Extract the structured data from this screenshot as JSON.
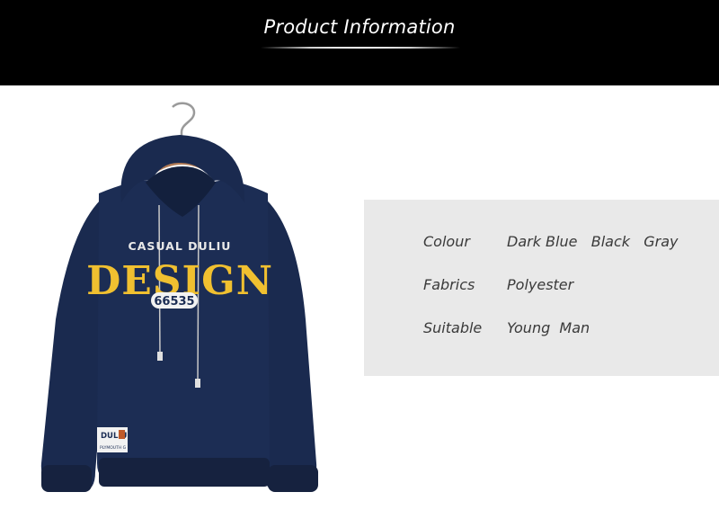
{
  "header": {
    "title": "Product  Information"
  },
  "product_image": {
    "print_line1": "CASUAL DULIU",
    "print_line2": "DESIGN",
    "print_number": "66535",
    "badge_line1": "DULIU",
    "badge_line3": "PLYMOUTH G"
  },
  "info": {
    "rows": [
      {
        "label": "Colour",
        "value": "Dark Blue   Black   Gray"
      },
      {
        "label": "Fabrics",
        "value": "Polyester"
      },
      {
        "label": "Suitable",
        "value": "Young  Man"
      }
    ]
  }
}
